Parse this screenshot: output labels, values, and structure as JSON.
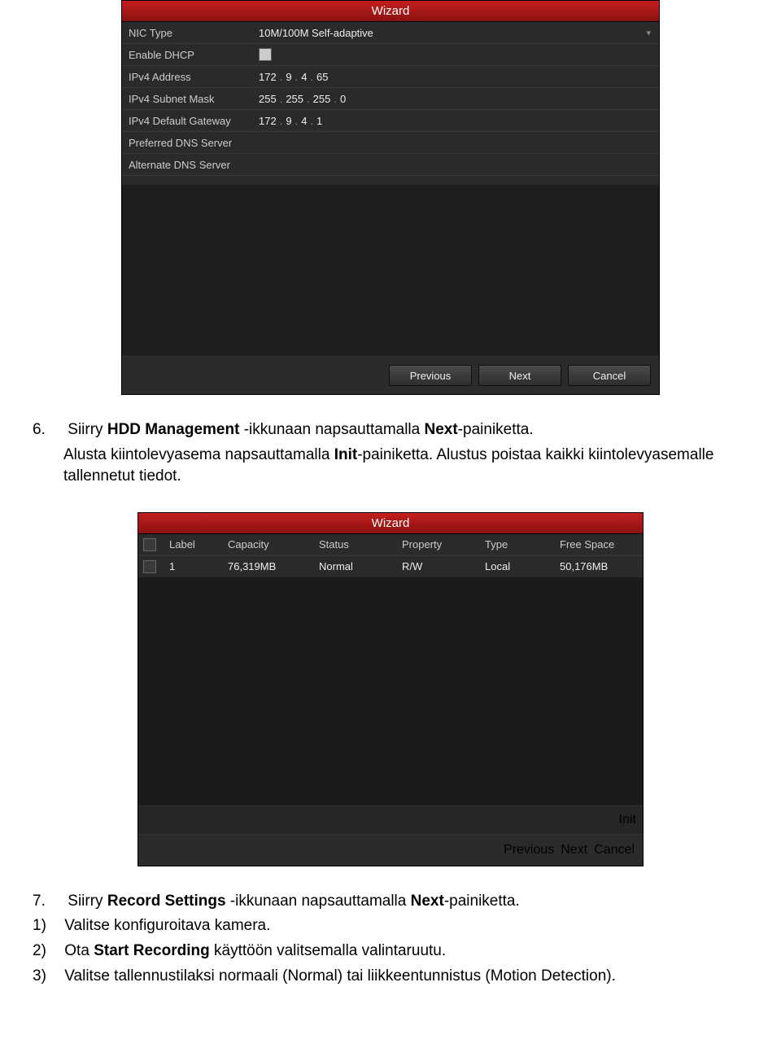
{
  "wizard1": {
    "title": "Wizard",
    "fields": {
      "nic_type_label": "NIC Type",
      "nic_type_value": "10M/100M Self-adaptive",
      "dhcp_label": "Enable DHCP",
      "ipv4_addr_label": "IPv4 Address",
      "ipv4_addr_o1": "172",
      "ipv4_addr_o2": "9",
      "ipv4_addr_o3": "4",
      "ipv4_addr_o4": "65",
      "ipv4_mask_label": "IPv4 Subnet Mask",
      "ipv4_mask_o1": "255",
      "ipv4_mask_o2": "255",
      "ipv4_mask_o3": "255",
      "ipv4_mask_o4": "0",
      "ipv4_gw_label": "IPv4 Default Gateway",
      "ipv4_gw_o1": "172",
      "ipv4_gw_o2": "9",
      "ipv4_gw_o3": "4",
      "ipv4_gw_o4": "1",
      "pref_dns_label": "Preferred DNS Server",
      "alt_dns_label": "Alternate DNS Server"
    },
    "buttons": {
      "previous": "Previous",
      "next": "Next",
      "cancel": "Cancel"
    }
  },
  "section6": {
    "num": "6.",
    "t1a": "Siirry ",
    "t1b": "HDD Management",
    "t1c": " -ikkunaan napsauttamalla ",
    "t1d": "Next",
    "t1e": "-painiketta.",
    "t2a": "Alusta kiintolevyasema napsauttamalla ",
    "t2b": "Init",
    "t2c": "-painiketta. Alustus poistaa kaikki kiintolevyasemalle tallennetut tiedot."
  },
  "wizard2": {
    "title": "Wizard",
    "columns": {
      "label": "Label",
      "capacity": "Capacity",
      "status": "Status",
      "property": "Property",
      "type": "Type",
      "free": "Free Space"
    },
    "row": {
      "label": "1",
      "capacity": "76,319MB",
      "status": "Normal",
      "property": "R/W",
      "type": "Local",
      "free": "50,176MB"
    },
    "buttons": {
      "init": "Init",
      "previous": "Previous",
      "next": "Next",
      "cancel": "Cancel"
    }
  },
  "section7": {
    "num": "7.",
    "t1a": "Siirry ",
    "t1b": "Record Settings",
    "t1c": " -ikkunaan napsauttamalla ",
    "t1d": "Next",
    "t1e": "-painiketta.",
    "li1n": "1)",
    "li1": "Valitse konfiguroitava kamera.",
    "li2n": "2)",
    "li2a": "Ota ",
    "li2b": "Start Recording",
    "li2c": " käyttöön valitsemalla valintaruutu.",
    "li3n": "3)",
    "li3": "Valitse tallennustilaksi normaali (Normal) tai liikkeentunnistus (Motion Detection)."
  }
}
